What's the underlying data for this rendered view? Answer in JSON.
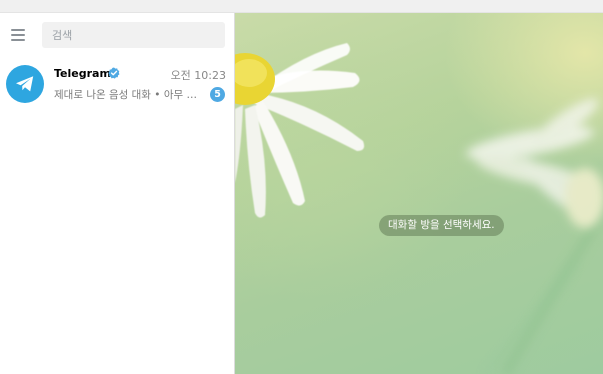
{
  "search": {
    "placeholder": "검색"
  },
  "chats": [
    {
      "name": "Telegram",
      "verified": true,
      "time": "오전 10:23",
      "preview": "제대로 나온 음성 대화 • 아무 보이스챗에서 ...",
      "unread": "5",
      "icon": "telegram-plane-icon",
      "avatar_color": "#2ea6e0"
    }
  ],
  "main": {
    "empty_hint": "대화할 방을 선택하세요."
  },
  "colors": {
    "accent": "#2ea6e0",
    "badge": "#4fa9e3",
    "verified": "#4fa9e3"
  }
}
